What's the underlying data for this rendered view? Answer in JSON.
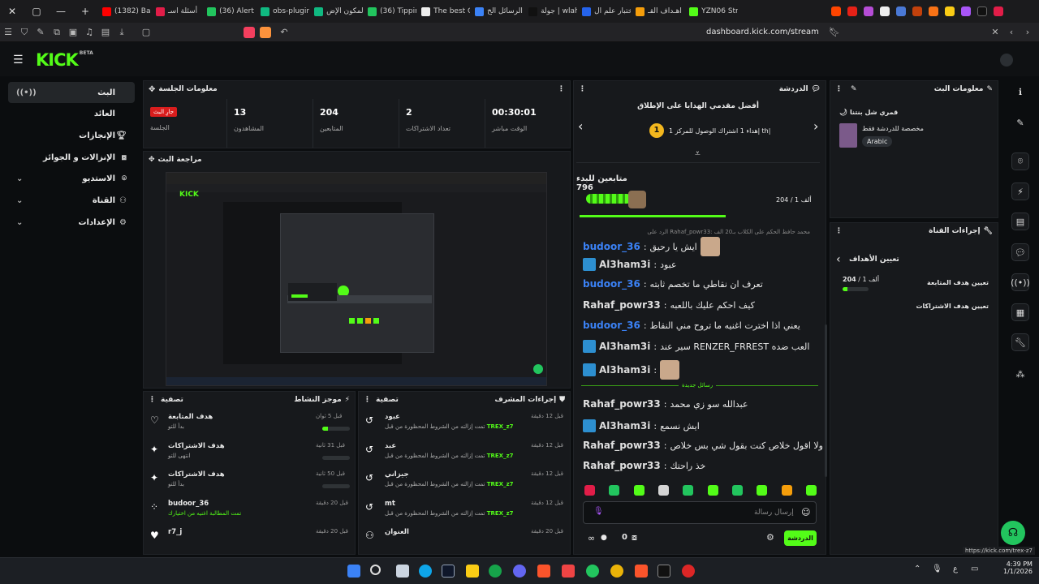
{
  "browser": {
    "tabs": [
      "(1382) Bam",
      "أسئلة اسـ",
      "(36) Alert B",
      "obs-plugin",
      "المكون الإض",
      "(36) Tippin",
      "The best C",
      "الرسائل الخ",
      "جولة | wlah",
      "اختبار علم ال",
      "اهـداف القـ",
      "YZN06 Stre"
    ],
    "url": "dashboard.kick.com/stream",
    "status_url": "https://kick.com/trex-z7"
  },
  "brand": {
    "logo": "KICK",
    "beta": "BETA",
    "accent": "#53fc18"
  },
  "nav": {
    "items": [
      {
        "label": "البث",
        "icon": "broadcast-icon"
      },
      {
        "label": "العائد",
        "icon": ""
      },
      {
        "label": "الإنجازات",
        "icon": "trophy-icon"
      },
      {
        "label": "الإنزالات و الجوائز",
        "icon": "gift-icon"
      },
      {
        "label": "الاستديو",
        "icon": "studio-icon"
      },
      {
        "label": "القناة",
        "icon": "channel-icon"
      },
      {
        "label": "الإعدادات",
        "icon": "gear-icon"
      }
    ]
  },
  "session": {
    "title": "معلومات الجلسة",
    "live_badge": "جارِ البث",
    "live_label": "الجلسة",
    "stats": [
      {
        "value": "13",
        "label": "المشاهدون"
      },
      {
        "value": "204",
        "label": "المتابعين"
      },
      {
        "value": "2",
        "label": "تعداد الاشتراكات"
      },
      {
        "value": "00:30:01",
        "label": "الوقت مباشر"
      }
    ]
  },
  "preview": {
    "title": "مراجعة البث"
  },
  "activity": {
    "title": "موجز النشاط",
    "filter": "تصفية",
    "rows": [
      {
        "title": "هدف المتابعة",
        "sub": "بدأ للتو",
        "time": "قبل 5 ثوان",
        "icon": "heart-outline-icon",
        "progress": 0.2
      },
      {
        "title": "هدف الاشتراكات",
        "sub": "انتهى للتو",
        "time": "قبل 31 ثانية",
        "icon": "sparkle-icon",
        "progress": 0
      },
      {
        "title": "هدف الاشتراكات",
        "sub": "بدأ للتو",
        "time": "قبل 50 ثانية",
        "icon": "sparkle-icon",
        "progress": 0
      },
      {
        "title": "budoor_36",
        "sub": "تمت المطالبة اغنيه من اختيارك",
        "time": "قبل 20 دقيقة",
        "icon": "user-group-icon",
        "progress": null
      },
      {
        "title": "r7_j",
        "sub": "",
        "time": "قبل 20 دقيقة",
        "icon": "heart-icon",
        "progress": null
      }
    ]
  },
  "modactions": {
    "title": "إجراءات المشرف",
    "filter": "تصفية",
    "rows": [
      {
        "title": "عبود",
        "sub": "تمت إزالته من الشروط المحظورة من قبل",
        "actor": "TREX_z7",
        "time": "قبل 12 دقيقة",
        "icon": "undo-icon"
      },
      {
        "title": "عبد",
        "sub": "تمت إزالته من الشروط المحظورة من قبل",
        "actor": "TREX_z7",
        "time": "قبل 12 دقيقة",
        "icon": "undo-icon"
      },
      {
        "title": "جيزاني",
        "sub": "تمت إزالته من الشروط المحظورة من قبل",
        "actor": "TREX_z7",
        "time": "قبل 12 دقيقة",
        "icon": "undo-icon"
      },
      {
        "title": "mt",
        "sub": "تمت إزالته من الشروط المحظورة من قبل",
        "actor": "TREX_z7",
        "time": "قبل 12 دقيقة",
        "icon": "undo-icon"
      },
      {
        "title": "العنوان",
        "sub": "",
        "actor": "",
        "time": "قبل 20 دقيقة",
        "icon": "user-icon"
      }
    ]
  },
  "chat": {
    "title": "الدردشة",
    "pinned_title": "أفضل مقدمي الهدايا على الإطلاق",
    "pinned_line": "إهداء 1 اشتراك الوصول للمركز 1 th|",
    "rank": "1",
    "goal_title": "متابعين للبدء 796",
    "goal_count": "204 / 1 ألف",
    "reply_hint": "الرد على Rahaf_powr33: محمد حافظ الحكم على الكلاب بـ20 الف",
    "messages": [
      {
        "user": "budoor_36",
        "color": "#3b82f6",
        "badge": false,
        "text": "ايش يا رحيق",
        "emote": true
      },
      {
        "user": "Al3ham3i",
        "color": "#dcdcdc",
        "badge": true,
        "text": "عبود",
        "emote": false
      },
      {
        "user": "budoor_36",
        "color": "#3b82f6",
        "badge": false,
        "text": "تعرف ان نقاطي ما تخصم ثابته",
        "emote": false
      },
      {
        "user": "Rahaf_powr33",
        "color": "#e0e0e0",
        "badge": false,
        "text": "كيف احكم عليك باللعبه",
        "emote": false
      },
      {
        "user": "budoor_36",
        "color": "#3b82f6",
        "badge": false,
        "text": "يعني اذا اخترت اغنيه ما تروح مني النقاط",
        "emote": false
      },
      {
        "user": "Al3ham3i",
        "color": "#dcdcdc",
        "badge": true,
        "text": "سير عند RENZER_FRREST العب ضده",
        "emote": false
      },
      {
        "user": "Al3ham3i",
        "color": "#dcdcdc",
        "badge": true,
        "text": "",
        "emote": true
      },
      {
        "user": "Rahaf_powr33",
        "color": "#e0e0e0",
        "badge": false,
        "text": "عبدالله سو زي محمد",
        "emote": false
      },
      {
        "user": "Al3ham3i",
        "color": "#dcdcdc",
        "badge": true,
        "text": "ايش نسمع",
        "emote": false
      },
      {
        "user": "Rahaf_powr33",
        "color": "#e0e0e0",
        "badge": false,
        "text": "ولا اقول خلاص كنت بقول شي بس خلاص",
        "emote": false
      },
      {
        "user": "Rahaf_powr33",
        "color": "#e0e0e0",
        "badge": false,
        "text": "خذ راحتك",
        "emote": false
      }
    ],
    "new_messages_divider": "رسائل جديدة",
    "input_placeholder": "إرسال رسالة",
    "send_label": "الدردشة",
    "points": "0"
  },
  "streaminfo": {
    "title": "معلومات البث",
    "stream_title": "قمري شل بنتنا",
    "category": "مخصصة للدردشة فقط",
    "language": "Arabic"
  },
  "channel_actions": {
    "title": "إجراءات القناة",
    "back_label": "تعيين الأهداف",
    "follow_goal": {
      "current": "204",
      "total": "1 ألف",
      "progress": 0.2
    },
    "items": [
      "تعيين هدف المتابعة",
      "تعيين هدف الاشتراكات"
    ]
  },
  "taskbar": {
    "time": "4:39 PM",
    "date": "1/1/2026"
  }
}
